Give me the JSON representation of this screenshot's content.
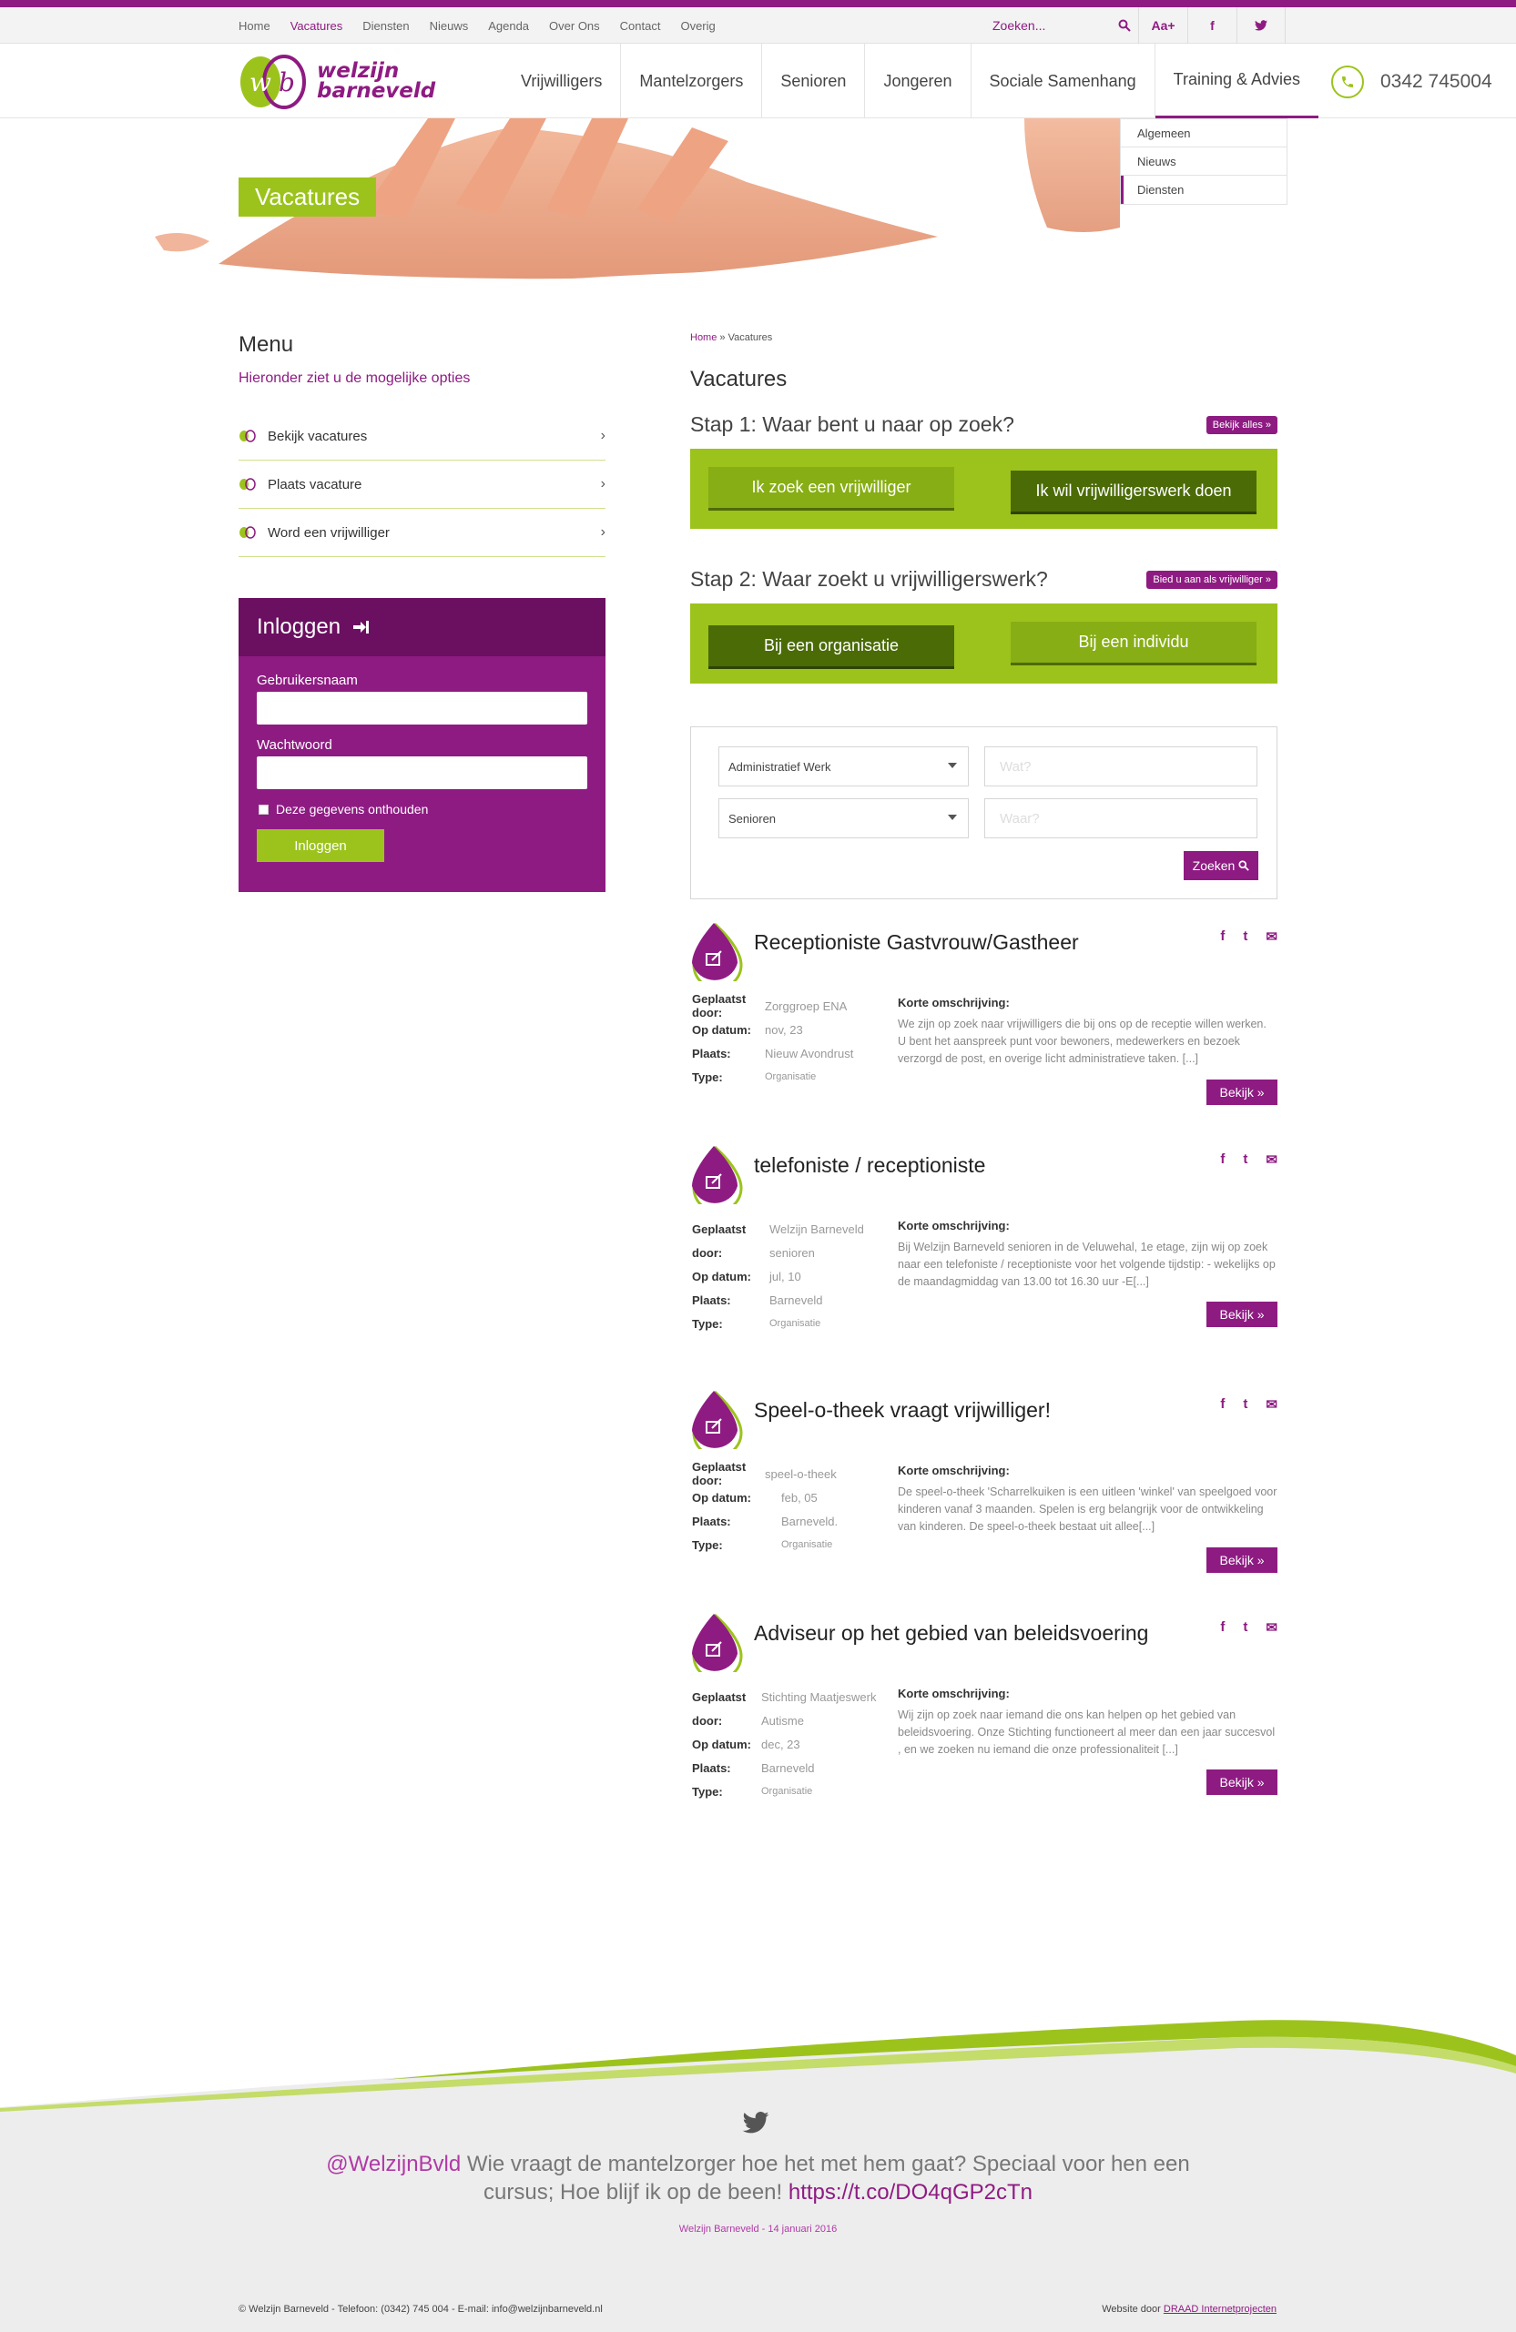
{
  "topnav": [
    "Home",
    "Vacatures",
    "Diensten",
    "Nieuws",
    "Agenda",
    "Over Ons",
    "Contact",
    "Overig"
  ],
  "search_placeholder": "Zoeken...",
  "font_size_label": "Aa+",
  "logo": {
    "line1": "welzijn",
    "line2": "barneveld"
  },
  "mainnav": [
    "Vrijwilligers",
    "Mantelzorgers",
    "Senioren",
    "Jongeren",
    "Sociale Samenhang",
    "Training & Advies"
  ],
  "phone": "0342 745004",
  "submenu": [
    "Algemeen",
    "Nieuws",
    "Diensten"
  ],
  "hero_title": "Vacatures",
  "sidebar": {
    "title": "Menu",
    "subtitle": "Hieronder ziet u de mogelijke opties",
    "items": [
      "Bekijk vacatures",
      "Plaats vacature",
      "Word een vrijwilliger"
    ]
  },
  "login": {
    "title": "Inloggen",
    "username_label": "Gebruikersnaam",
    "password_label": "Wachtwoord",
    "remember_label": "Deze gegevens onthouden",
    "button": "Inloggen"
  },
  "breadcrumb": {
    "home": "Home",
    "sep": " » ",
    "current": "Vacatures"
  },
  "page_title": "Vacatures",
  "step1": {
    "title": "Stap 1: Waar bent u naar op zoek?",
    "tag": "Bekijk alles »",
    "btn_left": "Ik zoek een vrijwilliger",
    "btn_right": "Ik wil vrijwilligerswerk doen"
  },
  "step2": {
    "title": "Stap 2: Waar zoekt u vrijwilligerswerk?",
    "tag": "Bied u aan als vrijwilliger »",
    "btn_left": "Bij een organisatie",
    "btn_right": "Bij een individu"
  },
  "filter": {
    "select1": "Administratief Werk",
    "select2": "Senioren",
    "input1_placeholder": "Wat?",
    "input2_placeholder": "Waar?",
    "button": "Zoeken"
  },
  "labels": {
    "posted_by": "Geplaatst door:",
    "posted_by_a": "Geplaatst",
    "posted_by_b": "door:",
    "date": "Op datum:",
    "place": "Plaats:",
    "type": "Type:",
    "desc": "Korte omschrijving:",
    "bekijk": "Bekijk »"
  },
  "vacancies": [
    {
      "title": "Receptioniste Gastvrouw/Gastheer",
      "by": "Zorggroep ENA",
      "date": "nov, 23",
      "place": "Nieuw Avondrust",
      "type": "Organisatie",
      "desc": "We zijn op zoek naar vrijwilligers die bij ons op de receptie willen werken. U bent het aanspreek punt voor bewoners, medewerkers en bezoek verzorgd de post, en overige licht administratieve taken. [...]"
    },
    {
      "title": "telefoniste / receptioniste",
      "by": "Welzijn Barneveld",
      "by2": "senioren",
      "date": "jul, 10",
      "place": "Barneveld",
      "type": "Organisatie",
      "desc": "Bij Welzijn Barneveld senioren in de Veluwehal, 1e etage, zijn wij op zoek naar een telefoniste / receptioniste voor het volgende tijdstip: - wekelijks op de maandagmiddag van 13.00 tot 16.30 uur -E[...]"
    },
    {
      "title": "Speel-o-theek vraagt vrijwilliger!",
      "by": "speel-o-theek",
      "date": "feb, 05",
      "place": "Barneveld.",
      "type": "Organisatie",
      "desc": "De speel-o-theek 'Scharrelkuiken is een uitleen 'winkel' van speelgoed voor kinderen vanaf 3 maanden. Spelen is erg belangrijk voor de ontwikkeling van kinderen. De speel-o-theek bestaat uit allee[...]"
    },
    {
      "title": "Adviseur op het gebied van beleidsvoering",
      "by": "Stichting Maatjeswerk",
      "by2": "Autisme",
      "date": "dec, 23",
      "place": "Barneveld",
      "type": "Organisatie",
      "desc": "Wij zijn op zoek naar  iemand die ons kan helpen op het gebied van beleidsvoering. Onze Stichting functioneert al meer dan een jaar succesvol , en we zoeken nu iemand die onze  professionaliteit [...]"
    }
  ],
  "tweet": {
    "handle": "@WelzijnBvld",
    "text1": " Wie vraagt de mantelzorger hoe het met hem gaat? Speciaal voor hen een",
    "text2": "cursus; Hoe blijf ik op de been! ",
    "link": "https://t.co/DO4qGP2cTn",
    "meta": "Welzijn Barneveld - 14 januari 2016"
  },
  "footer": {
    "copyright": "© Welzijn Barneveld - Telefoon: (0342) 745 004 - E-mail: info@welzijnbarneveld.nl",
    "credit_prefix": "Website door ",
    "credit_link": "DRAAD Internetprojecten"
  },
  "colors": {
    "purple": "#8e1b82",
    "green": "#9cc31c",
    "dark_green": "#4b6b07"
  }
}
